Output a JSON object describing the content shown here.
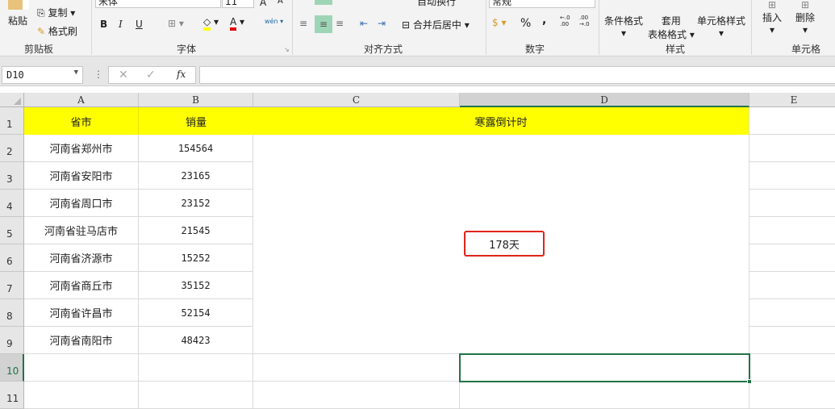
{
  "ribbon": {
    "clipboard": {
      "paste": "粘贴",
      "copy": "复制",
      "format_painter": "格式刷",
      "label": "剪贴板"
    },
    "font": {
      "name": "宋体",
      "size": "11",
      "bold": "B",
      "italic": "I",
      "underline": "U",
      "grow": "A",
      "shrink": "A",
      "phonetic": "wén",
      "label": "字体",
      "fill_color": "#ffff00",
      "font_color": "#e00000"
    },
    "alignment": {
      "wrap": "自动换行",
      "merge": "合并后居中",
      "label": "对齐方式"
    },
    "number": {
      "format": "常规",
      "percent": "%",
      "comma": ",",
      "inc_decimal": "←.0 .00",
      "dec_decimal": ".00 →.0",
      "label": "数字"
    },
    "styles": {
      "conditional": "条件格式",
      "table_format_1": "套用",
      "table_format_2": "表格格式",
      "cell_styles": "单元格样式",
      "label": "样式"
    },
    "cells": {
      "insert": "插入",
      "delete": "删除",
      "label": "单元格"
    }
  },
  "formula_bar": {
    "name_box": "D10",
    "fx": "fx",
    "value": ""
  },
  "sheet": {
    "columns": [
      "A",
      "B",
      "C",
      "D",
      "E"
    ],
    "rows": [
      "1",
      "2",
      "3",
      "4",
      "5",
      "6",
      "7",
      "8",
      "9",
      "10",
      "11"
    ],
    "header": {
      "a": "省市",
      "b": "销量",
      "cd": "寒露倒计时"
    },
    "data": [
      {
        "city": "河南省郑州市",
        "sales": "154564"
      },
      {
        "city": "河南省安阳市",
        "sales": "23165"
      },
      {
        "city": "河南省周口市",
        "sales": "23152"
      },
      {
        "city": "河南省驻马店市",
        "sales": "21545"
      },
      {
        "city": "河南省济源市",
        "sales": "15252"
      },
      {
        "city": "河南省商丘市",
        "sales": "35152"
      },
      {
        "city": "河南省许昌市",
        "sales": "52154"
      },
      {
        "city": "河南省南阳市",
        "sales": "48423"
      }
    ],
    "countdown": "178天",
    "selected_cell": "D10",
    "header_fill": "#ffff00",
    "highlight_border": "#e0251b",
    "selection_color": "#217346"
  }
}
